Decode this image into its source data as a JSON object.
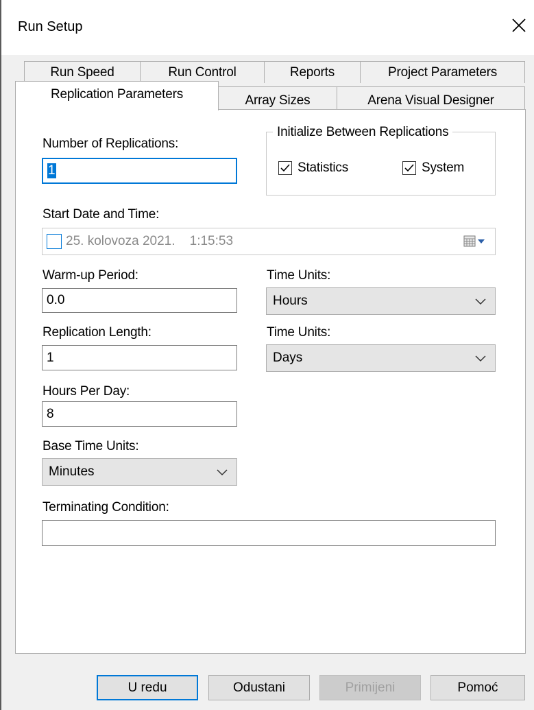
{
  "window": {
    "title": "Run Setup"
  },
  "tabs_back": [
    "Run Speed",
    "Run Control",
    "Reports",
    "Project Parameters"
  ],
  "tabs_front": [
    "Replication Parameters",
    "Array Sizes",
    "Arena Visual Designer"
  ],
  "form": {
    "num_replications_label": "Number of Replications:",
    "num_replications_value": "1",
    "init_group_title": "Initialize Between Replications",
    "statistics_label": "Statistics",
    "system_label": "System",
    "start_label": "Start Date and Time:",
    "start_value": "25. kolovoza 2021.    1:15:53",
    "warmup_label": "Warm-up Period:",
    "warmup_value": "0.0",
    "time_units_label_1": "Time Units:",
    "time_units_value_1": "Hours",
    "replication_length_label": "Replication Length:",
    "replication_length_value": "1",
    "time_units_label_2": "Time Units:",
    "time_units_value_2": "Days",
    "hours_per_day_label": "Hours Per Day:",
    "hours_per_day_value": "8",
    "base_time_units_label": "Base Time Units:",
    "base_time_units_value": "Minutes",
    "terminating_label": "Terminating Condition:",
    "terminating_value": ""
  },
  "buttons": {
    "ok": "U redu",
    "cancel": "Odustani",
    "apply": "Primijeni",
    "help": "Pomoć"
  },
  "colors": {
    "accent": "#0078d7",
    "panel_bg": "#ffffff",
    "dialog_bg": "#f0f0f0"
  }
}
